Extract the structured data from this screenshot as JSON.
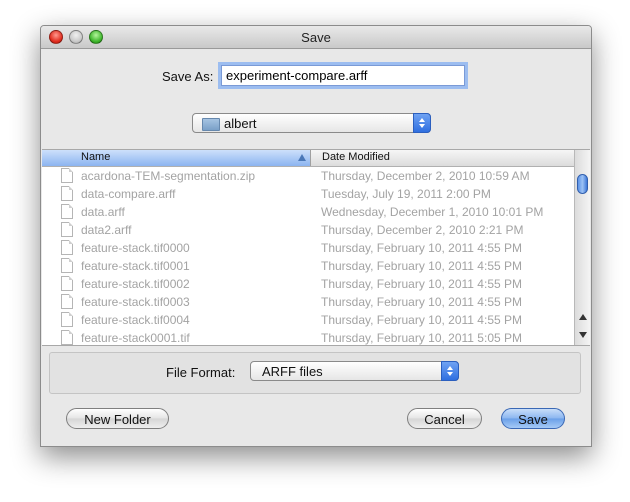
{
  "window": {
    "title": "Save"
  },
  "save_as": {
    "label": "Save As:",
    "value": "experiment-compare.arff"
  },
  "location": {
    "selected": "albert",
    "icon": "folder-icon"
  },
  "file_list": {
    "columns": [
      "Name",
      "Date Modified"
    ],
    "sort_column": "Name",
    "sort_direction": "ascending",
    "rows": [
      {
        "name": "acardona-TEM-segmentation.zip",
        "date": "Thursday, December 2, 2010 10:59 AM",
        "icon": "zip-file-icon"
      },
      {
        "name": "data-compare.arff",
        "date": "Tuesday, July 19, 2011 2:00 PM",
        "icon": "document-icon"
      },
      {
        "name": "data.arff",
        "date": "Wednesday, December 1, 2010 10:01 PM",
        "icon": "document-icon"
      },
      {
        "name": "data2.arff",
        "date": "Thursday, December 2, 2010 2:21 PM",
        "icon": "document-icon"
      },
      {
        "name": "feature-stack.tif0000",
        "date": "Thursday, February 10, 2011 4:55 PM",
        "icon": "document-icon"
      },
      {
        "name": "feature-stack.tif0001",
        "date": "Thursday, February 10, 2011 4:55 PM",
        "icon": "document-icon"
      },
      {
        "name": "feature-stack.tif0002",
        "date": "Thursday, February 10, 2011 4:55 PM",
        "icon": "document-icon"
      },
      {
        "name": "feature-stack.tif0003",
        "date": "Thursday, February 10, 2011 4:55 PM",
        "icon": "document-icon"
      },
      {
        "name": "feature-stack.tif0004",
        "date": "Thursday, February 10, 2011 4:55 PM",
        "icon": "document-icon"
      },
      {
        "name": "feature-stack0001.tif",
        "date": "Thursday, February 10, 2011 5:05 PM",
        "icon": "image-file-icon"
      }
    ]
  },
  "file_format": {
    "label": "File Format:",
    "selected": "ARFF files"
  },
  "buttons": {
    "new_folder": "New Folder",
    "cancel": "Cancel",
    "save": "Save"
  },
  "colors": {
    "accent": "#6a9fe8",
    "dimmed_text": "#a3a3a3"
  }
}
